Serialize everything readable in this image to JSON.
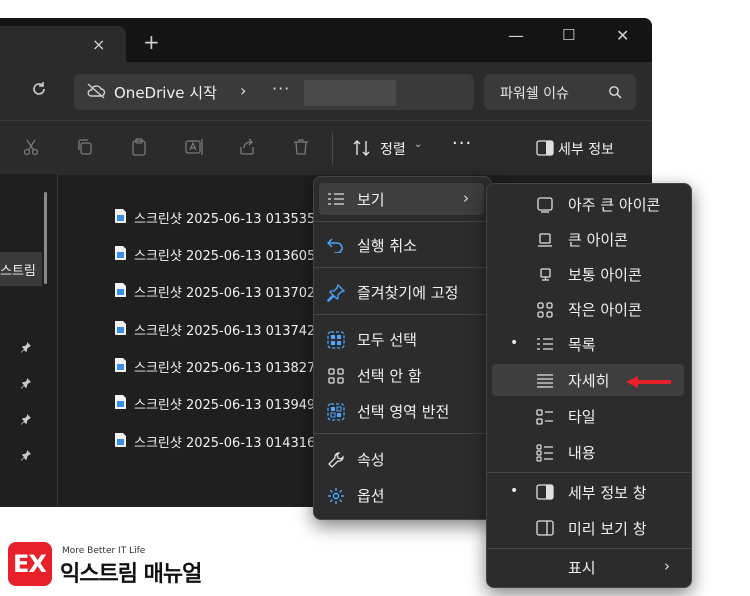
{
  "window": {
    "tab_close": "×",
    "new_tab": "+",
    "minimize": "—",
    "maximize": "☐",
    "close": "✕"
  },
  "address": {
    "path": "OneDrive 시작",
    "chevron": "›",
    "more": "···"
  },
  "search": {
    "placeholder": "파워쉘 이슈"
  },
  "toolbar": {
    "sort_label": "정렬",
    "more_label": "···",
    "details_label": "세부 정보"
  },
  "nav": {
    "item_label": "스트림"
  },
  "files": [
    "스크린샷 2025-06-13 013535",
    "스크린샷 2025-06-13 013605",
    "스크린샷 2025-06-13 013702",
    "스크린샷 2025-06-13 013742",
    "스크린샷 2025-06-13 013827",
    "스크린샷 2025-06-13 013949",
    "스크린샷 2025-06-13 014316"
  ],
  "context_menu": {
    "view": "보기",
    "undo": "실행 취소",
    "pin": "즐겨찾기에 고정",
    "select_all": "모두 선택",
    "select_none": "선택 안 함",
    "invert": "선택 영역 반전",
    "properties": "속성",
    "options": "옵션"
  },
  "view_menu": {
    "extra_large": "아주 큰 아이콘",
    "large": "큰 아이콘",
    "medium": "보통 아이콘",
    "small": "작은 아이콘",
    "list": "목록",
    "details": "자세히",
    "tiles": "타일",
    "content": "내용",
    "details_pane": "세부 정보 창",
    "preview_pane": "미리 보기 창",
    "show": "표시",
    "bullet": "•"
  },
  "logo": {
    "mark": "EX",
    "tagline": "More Better IT Life",
    "name": "익스트림 매뉴얼"
  },
  "colors": {
    "accent_blue": "#4da3ff",
    "arrow_red": "#e8202a",
    "menu_bg": "#2c2c2c"
  }
}
